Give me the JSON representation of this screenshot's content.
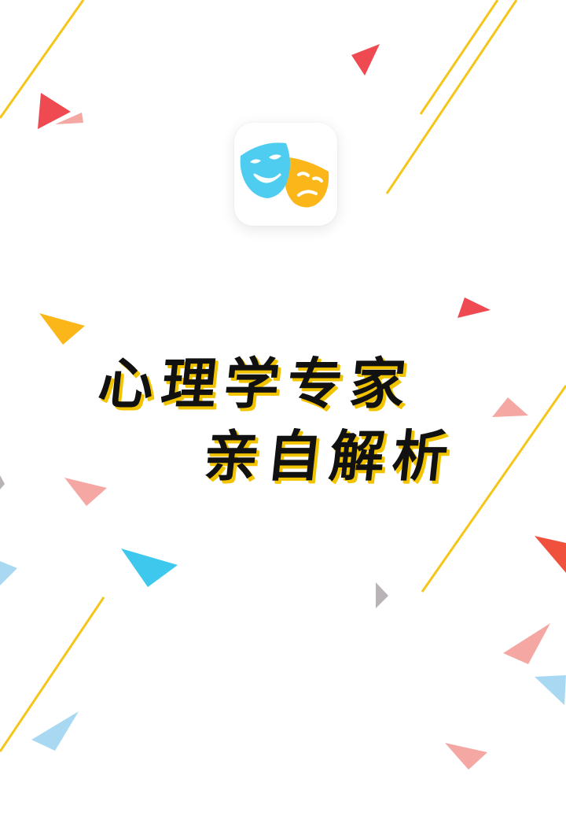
{
  "headline": {
    "line1": "心理学专家",
    "line2": "亲自解析"
  },
  "app_icon": {
    "name": "theater-masks-icon",
    "colors": {
      "mask_front": "#4fcdf0",
      "mask_back": "#fbb61a",
      "mask_features": "#ffffff"
    }
  },
  "colors": {
    "background": "#ffffff",
    "line": "#f5c518",
    "accent_red": "#ef4a52",
    "accent_pink": "#f4a7a3",
    "accent_yellow": "#fbb61a",
    "accent_blue": "#3ec8ee",
    "accent_light_blue": "#a9d9f2",
    "accent_gray": "#b8b3b6",
    "text": "#111111",
    "text_shadow": "#f2c400"
  }
}
